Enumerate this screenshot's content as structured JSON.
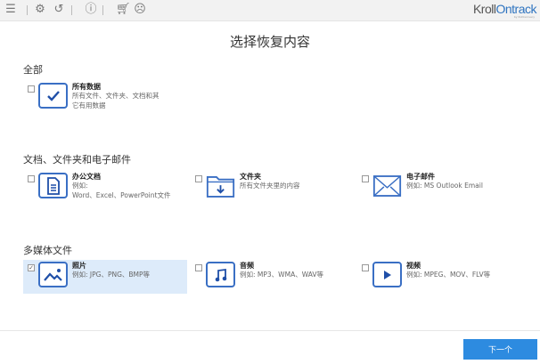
{
  "toolbar": {
    "icons": [
      "menu-icon",
      "settings-icon",
      "history-icon",
      "info-icon",
      "cart-icon",
      "account-icon"
    ],
    "logo": {
      "part1": "Kroll",
      "part2": "Ontrack",
      "sub": "by KLDiscovery"
    }
  },
  "title": "选择恢复内容",
  "sections": [
    {
      "label": "全部",
      "items": [
        {
          "name": "所有数据",
          "desc1": "所有文件、文件夹、文档和其",
          "desc2": "它有用数据",
          "checked": false
        }
      ]
    },
    {
      "label": "文档、文件夹和电子邮件",
      "items": [
        {
          "name": "办公文档",
          "desc1": "例如:",
          "desc2": "Word、Excel、PowerPoint文件",
          "checked": false
        },
        {
          "name": "文件夹",
          "desc1": "所有文件夹里的内容",
          "desc2": "",
          "checked": false
        },
        {
          "name": "电子邮件",
          "desc1": "例如: MS Outlook Email",
          "desc2": "",
          "checked": false
        }
      ]
    },
    {
      "label": "多媒体文件",
      "items": [
        {
          "name": "照片",
          "desc1": "例如: JPG、PNG、BMP等",
          "desc2": "",
          "checked": true
        },
        {
          "name": "音频",
          "desc1": "例如: MP3、WMA、WAV等",
          "desc2": "",
          "checked": false
        },
        {
          "name": "视频",
          "desc1": "例如: MPEG、MOV、FLV等",
          "desc2": "",
          "checked": false
        }
      ]
    }
  ],
  "check_mark": "✓",
  "next_button": "下一个",
  "colors": {
    "accent": "#2d8be0",
    "icon": "#3a6fc4",
    "selected_bg": "#ddebfa"
  }
}
